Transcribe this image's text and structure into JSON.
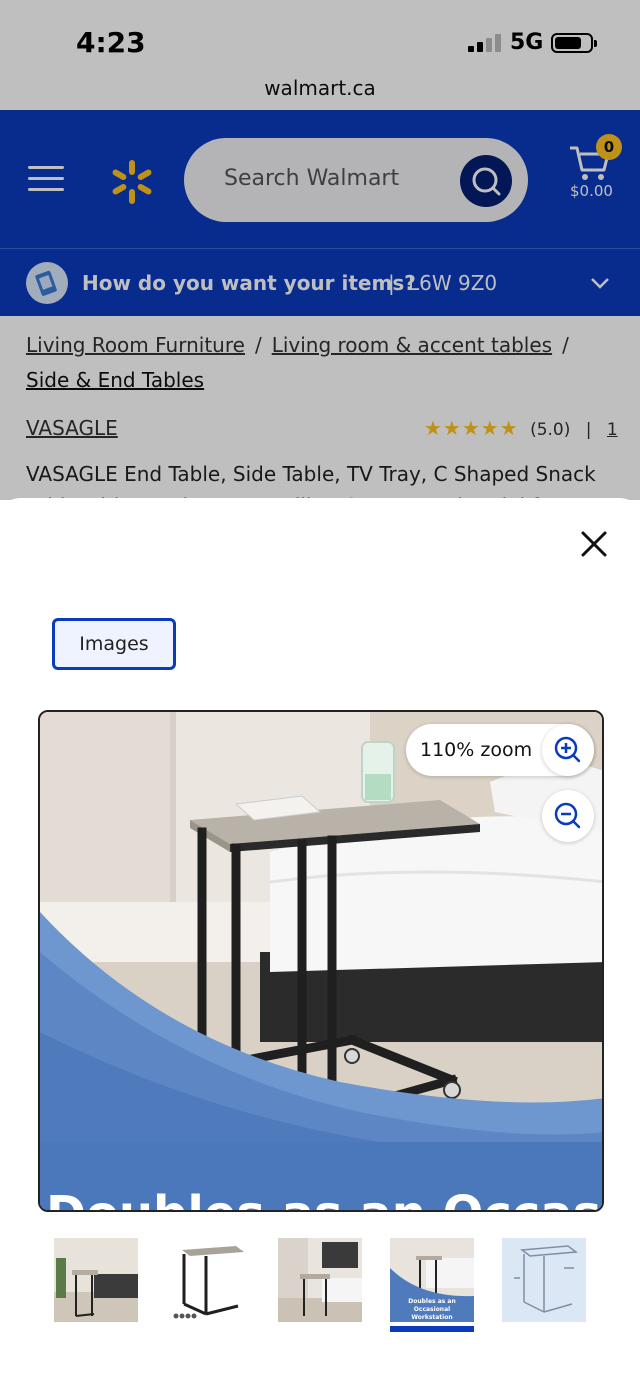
{
  "status_bar": {
    "time": "4:23",
    "network": "5G"
  },
  "browser": {
    "url": "walmart.ca"
  },
  "header": {
    "search_placeholder": "Search Walmart",
    "cart_count": "0",
    "cart_total": "$0.00",
    "brand_color": "#0b3bbd",
    "accent_color": "#ffc220"
  },
  "delivery": {
    "question": "How do you want your items?",
    "separator": "|",
    "postal_code": "L6W 9Z0"
  },
  "breadcrumbs": {
    "items": [
      "Living Room Furniture",
      "Living room & accent tables"
    ],
    "separator": "/",
    "current": "Side & End Tables"
  },
  "product": {
    "brand": "VASAGLE",
    "rating": "(5.0)",
    "rating_value": 5,
    "review_separator": "|",
    "review_count": "1",
    "title": "VASAGLE End Table, Side Table, TV Tray, C Shaped Snack Table with Metal Frame, Rolling Casters, Industrial for"
  },
  "modal": {
    "tab_label": "Images",
    "zoom_label": "110% zoom",
    "image_caption": "Doubles as an Occasional",
    "thumb_caption": "Doubles as an Occasional Workstation",
    "thumbnails": [
      "thumb-1",
      "thumb-2",
      "thumb-3",
      "thumb-4",
      "thumb-5"
    ],
    "selected_thumbnail": 4
  }
}
